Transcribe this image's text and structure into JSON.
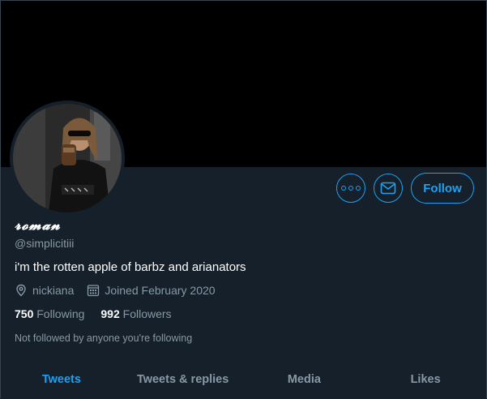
{
  "profile": {
    "display_name": "𝓻𝓸𝓶𝓪𝓷",
    "handle": "@simplicitiii",
    "bio": "i'm the rotten apple of barbz and arianators",
    "location": "nickiana",
    "joined": "Joined February 2020",
    "following_count": "750",
    "following_label": "Following",
    "followers_count": "992",
    "followers_label": "Followers",
    "followed_by_note": "Not followed by anyone you're following"
  },
  "actions": {
    "more_icon": "more-icon",
    "message_icon": "mail-icon",
    "follow_label": "Follow"
  },
  "tabs": [
    {
      "label": "Tweets",
      "active": true
    },
    {
      "label": "Tweets & replies",
      "active": false
    },
    {
      "label": "Media",
      "active": false
    },
    {
      "label": "Likes",
      "active": false
    }
  ],
  "colors": {
    "background": "#15202b",
    "accent": "#1da1f2",
    "secondary_text": "#8899a6",
    "banner": "#000000"
  }
}
